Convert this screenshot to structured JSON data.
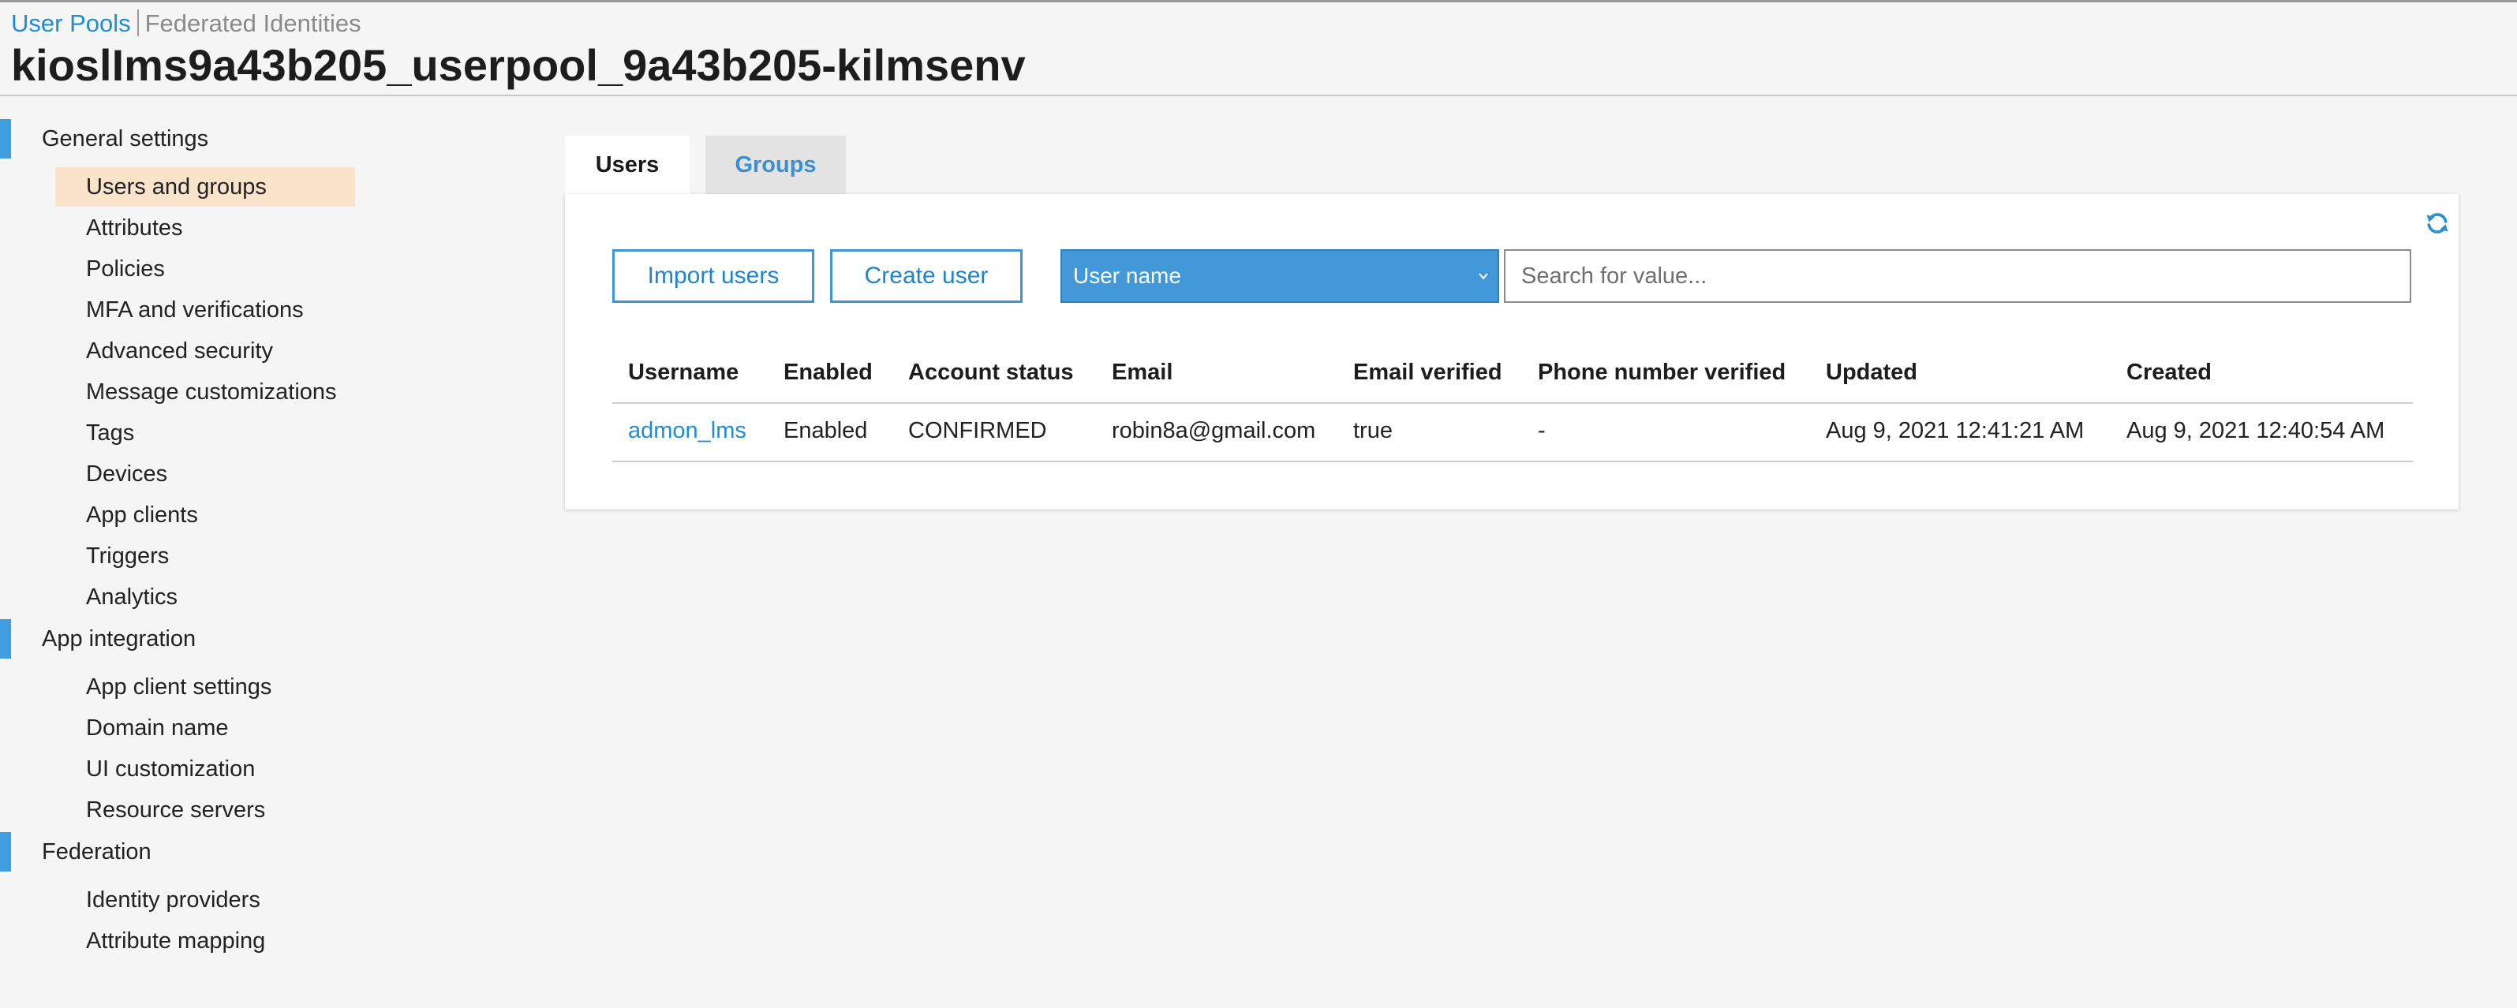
{
  "breadcrumb": {
    "user_pools": "User Pools",
    "federated_identities": "Federated Identities"
  },
  "page_title": "kioslIms9a43b205_userpool_9a43b205-kilmsenv",
  "sidebar": {
    "sections": [
      {
        "label": "General settings",
        "items": [
          {
            "label": "Users and groups",
            "active": true
          },
          {
            "label": "Attributes"
          },
          {
            "label": "Policies"
          },
          {
            "label": "MFA and verifications"
          },
          {
            "label": "Advanced security"
          },
          {
            "label": "Message customizations"
          },
          {
            "label": "Tags"
          },
          {
            "label": "Devices"
          },
          {
            "label": "App clients"
          },
          {
            "label": "Triggers"
          },
          {
            "label": "Analytics"
          }
        ]
      },
      {
        "label": "App integration",
        "items": [
          {
            "label": "App client settings"
          },
          {
            "label": "Domain name"
          },
          {
            "label": "UI customization"
          },
          {
            "label": "Resource servers"
          }
        ]
      },
      {
        "label": "Federation",
        "items": [
          {
            "label": "Identity providers"
          },
          {
            "label": "Attribute mapping"
          }
        ]
      }
    ]
  },
  "tabs": [
    {
      "label": "Users",
      "active": true
    },
    {
      "label": "Groups",
      "active": false
    }
  ],
  "toolbar": {
    "import_label": "Import users",
    "create_label": "Create user",
    "filter_selected": "User name",
    "search_placeholder": "Search for value..."
  },
  "table": {
    "columns": [
      "Username",
      "Enabled",
      "Account status",
      "Email",
      "Email verified",
      "Phone number verified",
      "Updated",
      "Created"
    ],
    "rows": [
      [
        "admon_lms",
        "Enabled",
        "CONFIRMED",
        "robin8a@gmail.com",
        "true",
        "-",
        "Aug 9, 2021 12:41:21 AM",
        "Aug 9, 2021 12:40:54 AM"
      ]
    ]
  },
  "colors": {
    "accent": "#3f9de0",
    "link": "#1f8dd6",
    "active_item_bg": "#f9e3cb",
    "select_bg": "#4399d7"
  },
  "icons": {
    "refresh": "refresh-icon",
    "dropdown": "chevron-down-icon"
  }
}
